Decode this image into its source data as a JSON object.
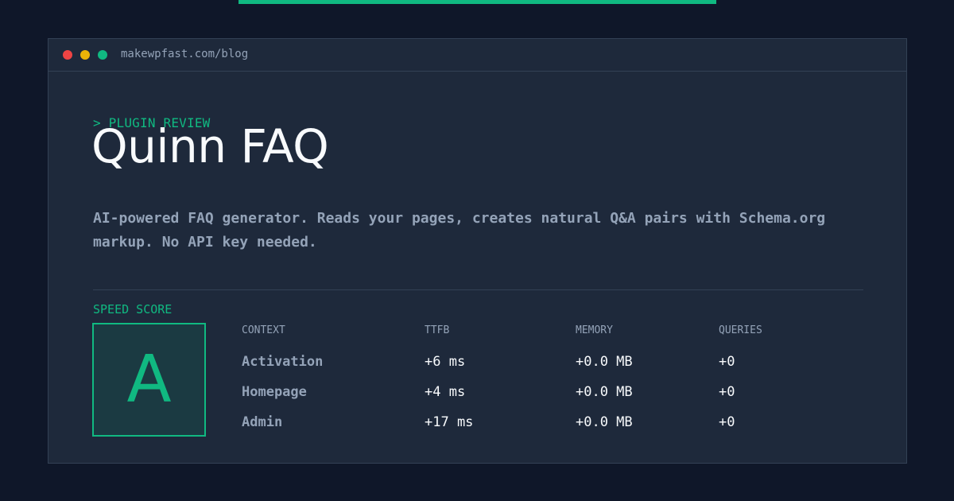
{
  "window": {
    "url": "makewpfast.com/blog",
    "controls": [
      "close",
      "minimize",
      "zoom"
    ]
  },
  "page": {
    "kicker": "> PLUGIN REVIEW",
    "title": "Quinn FAQ",
    "description_lines": [
      "AI-powered FAQ generator. Reads your pages, creates natural Q&A pairs with Schema.org",
      "markup. No API key needed."
    ]
  },
  "speed_score": {
    "label": "SPEED SCORE",
    "grade": "A"
  },
  "metrics": {
    "headers": [
      "CONTEXT",
      "TTFB",
      "MEMORY",
      "QUERIES"
    ],
    "rows": [
      [
        "Activation",
        "+6 ms",
        "+0.0 MB",
        "+0"
      ],
      [
        "Homepage",
        "+4 ms",
        "+0.0 MB",
        "+0"
      ],
      [
        "Admin",
        "+17 ms",
        "+0.0 MB",
        "+0"
      ]
    ]
  },
  "colors": {
    "background": "#0f1729",
    "panel": "#1e293b",
    "accent": "#10b981",
    "text": "#f8fafc",
    "muted": "#94a3b8"
  }
}
